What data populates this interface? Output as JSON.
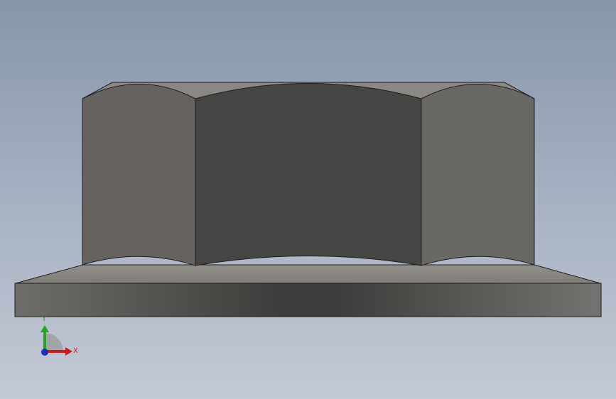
{
  "viewport": {
    "background_top": "#8796ab",
    "background_bottom": "#c4cad5"
  },
  "model": {
    "colors": {
      "edge": "#1e1e1e",
      "front_face": "#464644",
      "side_face": "#6a6865",
      "chamfer": "#8a8784",
      "flange_top": "#8b8884",
      "flange_front_dark": "#3d3d3b",
      "flange_front_light": "#6f6d69"
    }
  },
  "triad": {
    "y_label": "Y",
    "x_label": "X",
    "y_color": "#27a322",
    "x_color": "#c42020",
    "z_color": "#1c2fb5"
  }
}
